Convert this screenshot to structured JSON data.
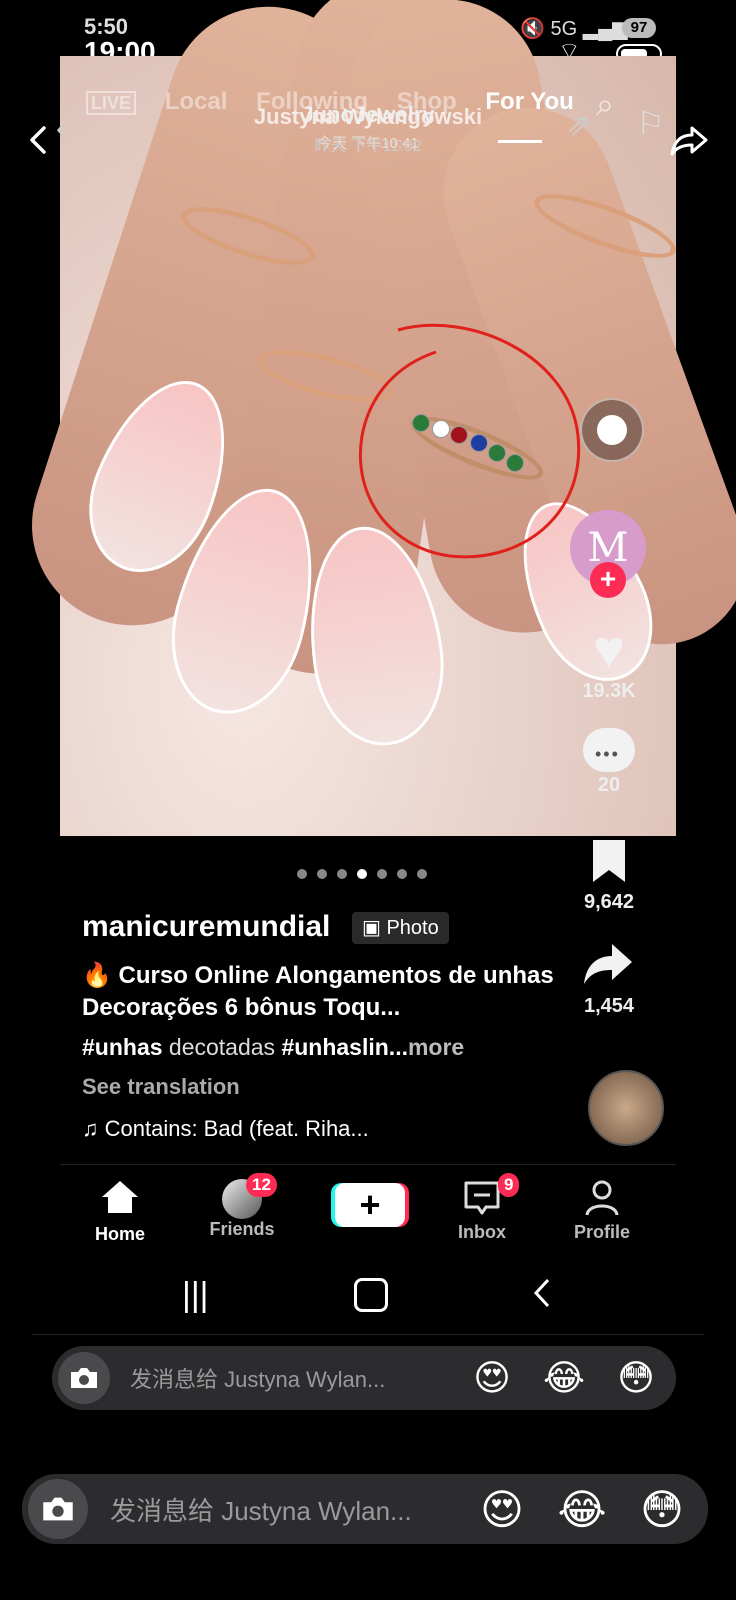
{
  "outer_header": {
    "name": "JunoJewelry",
    "time": "昨天 下午11:02"
  },
  "inner_status": {
    "time_top": "5:50",
    "time_main": "19:00",
    "network": "5G",
    "battery": "97"
  },
  "inner_header": {
    "name": "Justyna Wylangowski",
    "time": "今天 下午10:41"
  },
  "feed_tabs": [
    "LIVE",
    "Local",
    "Following",
    "Shop",
    "For You"
  ],
  "active_tab": "For You",
  "right_rail": {
    "likes": "19.3K",
    "comments": "20",
    "saves": "9,642",
    "shares": "1,454"
  },
  "post": {
    "username": "manicuremundial",
    "badge": "Photo",
    "caption": "🔥 Curso Online Alongamentos de unhas Decorações 6 bônus Toqu...",
    "hashtag1": "#unhas",
    "hashtag_text": " decotadas ",
    "hashtag2": "#unhaslin...",
    "more": "more",
    "see_translation": "See translation",
    "music": "♫ Contains: Bad (feat. Riha..."
  },
  "bottom_nav": {
    "home": "Home",
    "friends": "Friends",
    "friends_badge": "12",
    "inbox": "Inbox",
    "inbox_badge": "9",
    "profile": "Profile"
  },
  "inner_message": {
    "placeholder": "发消息给 Justyna Wylan...",
    "emojis": [
      "😍",
      "😂",
      "😳"
    ]
  },
  "outer_message": {
    "placeholder": "发消息给 Justyna Wylan...",
    "emojis": [
      "😍",
      "😂",
      "😳"
    ]
  },
  "colors": {
    "accent_red": "#fe2c55",
    "accent_cyan": "#25f4ee",
    "bar_bg": "#2c2c2e"
  }
}
